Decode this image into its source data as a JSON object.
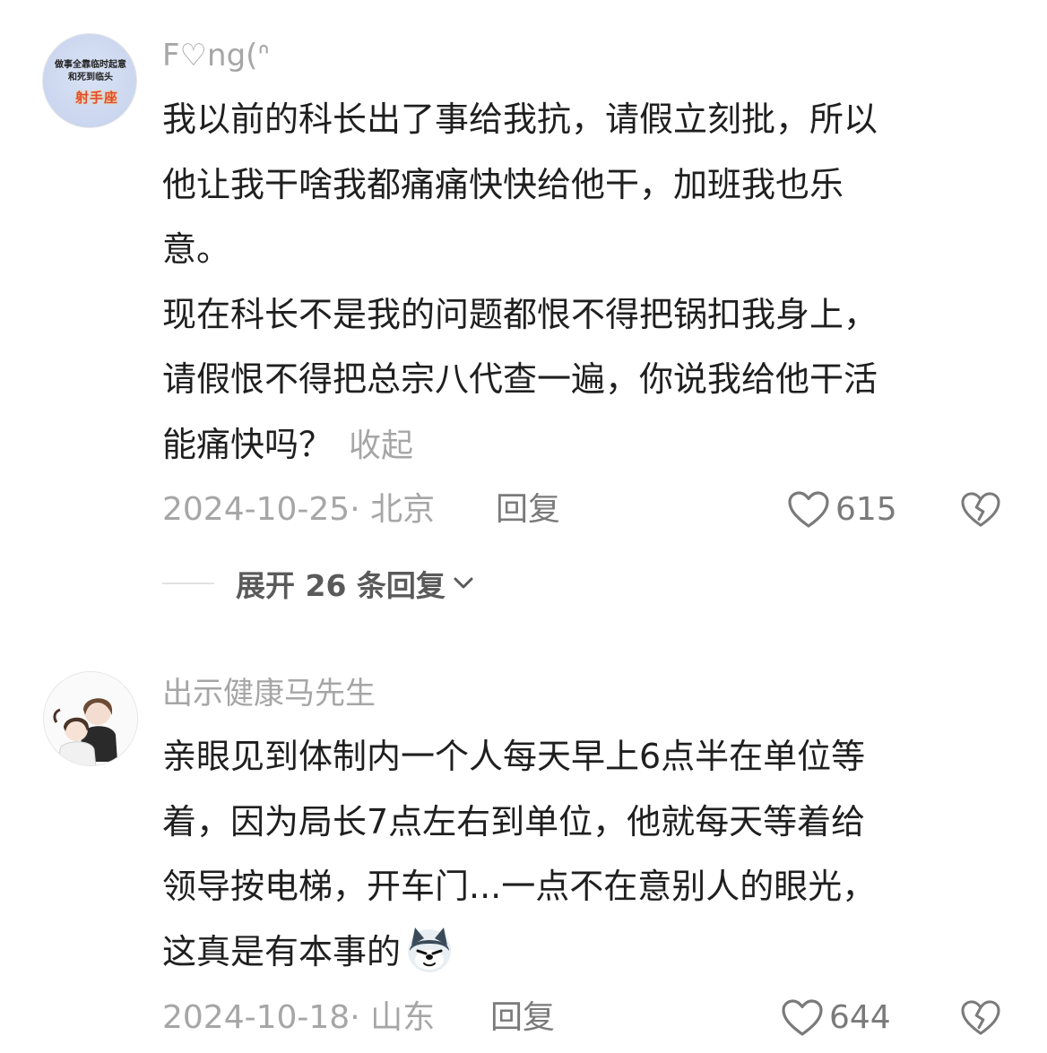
{
  "comments": [
    {
      "username": "F♡ng(ᐢ",
      "avatar": {
        "line1": "做事全靠临时起意",
        "line2": "和死到临头",
        "badge": "射手座"
      },
      "lines": [
        "我以前的科长出了事给我抗，请假立刻批，所以",
        "他让我干啥我都痛痛快快给他干，加班我也乐",
        "意。",
        "现在科长不是我的问题都恨不得把锅扣我身上，",
        "请假恨不得把总宗八代查一遍，你说我给他干活",
        "能痛快吗？"
      ],
      "collapse_label": "收起",
      "date": "2024-10-25· 北京",
      "reply_label": "回复",
      "likes": "615",
      "expand_label": "展开 26 条回复"
    },
    {
      "username": "出示健康马先生",
      "lines": [
        "亲眼见到体制内一个人每天早上6点半在单位等",
        "着，因为局长7点左右到单位，他就每天等着给",
        "领导按电梯，开车门...一点不在意别人的眼光，",
        "这真是有本事的"
      ],
      "emoji": "wolf-emoji",
      "date": "2024-10-18· 山东",
      "reply_label": "回复",
      "likes": "644"
    }
  ],
  "colors": {
    "text": "#1f1f1f",
    "muted": "#a6a6a6",
    "action": "#7a7a7a"
  }
}
